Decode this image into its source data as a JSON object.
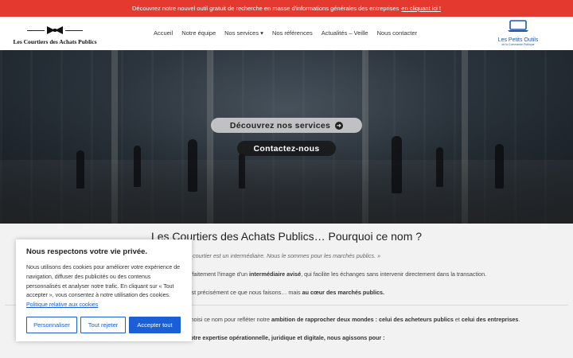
{
  "topbar": {
    "text": "Découvrez notre nouvel outil gratuit de recherche en masse d'informations générales des entreprises",
    "link": "en cliquant ici !"
  },
  "header": {
    "logo_text": "Les Courtiers des Achats Publics",
    "nav": [
      "Accueil",
      "Notre équipe",
      "Nos services",
      "Nos références",
      "Actualités – Veille",
      "Nous contacter"
    ],
    "services_caret": "▾",
    "partner_label": "Les Petits Outils",
    "partner_sub": "de la Commande Publique"
  },
  "hero": {
    "btn_services": "Découvrez nos services",
    "btn_services_icon": "➜",
    "btn_contact": "Contactez-nous"
  },
  "main": {
    "title": "Les Courtiers des Achats Publics… Pourquoi ce nom ?",
    "quote": "« Le courtier est un intermédiaire. Nous le sommes pour les marchés publics. »",
    "p1_a": "Il incarne parfaitement l'image d'un",
    "p1_b": "intermédiaire avisé",
    "p1_c": ", qui facilite les échanges sans intervenir directement dans la transaction.",
    "p2_a": "C'est précisément ce que nous faisons… mais",
    "p2_b": "au cœur des marchés publics.",
    "p3_a": "Nous avons choisi ce nom pour refléter notre",
    "p3_b": "ambition de rapprocher deux mondes",
    "p3_c": ": celui des acheteurs publics",
    "p3_d": "et",
    "p3_e": "celui des entreprises",
    "p3_f": ".",
    "p4": "Grâce à notre expertise opérationnelle, juridique et digitale, nous agissons pour :"
  },
  "cookie": {
    "title": "Nous respectons votre vie privée.",
    "text": "Nous utilisons des cookies pour améliorer votre expérience de navigation, diffuser des publicités ou des contenus personnalisés et analyser notre trafic. En cliquant sur « Tout accepter », vous consentez à notre utilisation des cookies.",
    "policy_link": "Politique relative aux cookies",
    "btn_customize": "Personnaliser",
    "btn_reject": "Tout rejeter",
    "btn_accept": "Accepter tout"
  },
  "colors": {
    "topbar": "#e3392e",
    "cookie_accent": "#1a5fd6",
    "partner": "#1f5aa6"
  }
}
